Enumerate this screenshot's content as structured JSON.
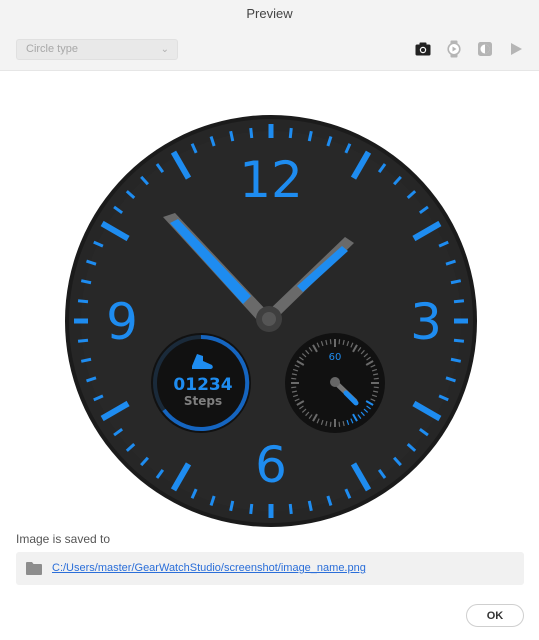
{
  "window": {
    "title": "Preview"
  },
  "toolbar": {
    "shape_select": {
      "value": "Circle type"
    },
    "icons": [
      "camera-icon",
      "watch-icon",
      "ambient-mode-icon",
      "play-icon"
    ]
  },
  "watch": {
    "numerals": {
      "twelve": "12",
      "three": "3",
      "six": "6",
      "nine": "9"
    },
    "steps": {
      "value": "01234",
      "label": "Steps",
      "icon": "shoe-icon"
    },
    "subdial": {
      "label": "60"
    },
    "colors": {
      "accent": "#1e8cf0",
      "face": "#262626",
      "bezel": "#1b1b1b"
    }
  },
  "save": {
    "label": "Image is saved to",
    "path": "C:/Users/master/GearWatchStudio/screenshot/image_name.png"
  },
  "buttons": {
    "ok": "OK"
  }
}
